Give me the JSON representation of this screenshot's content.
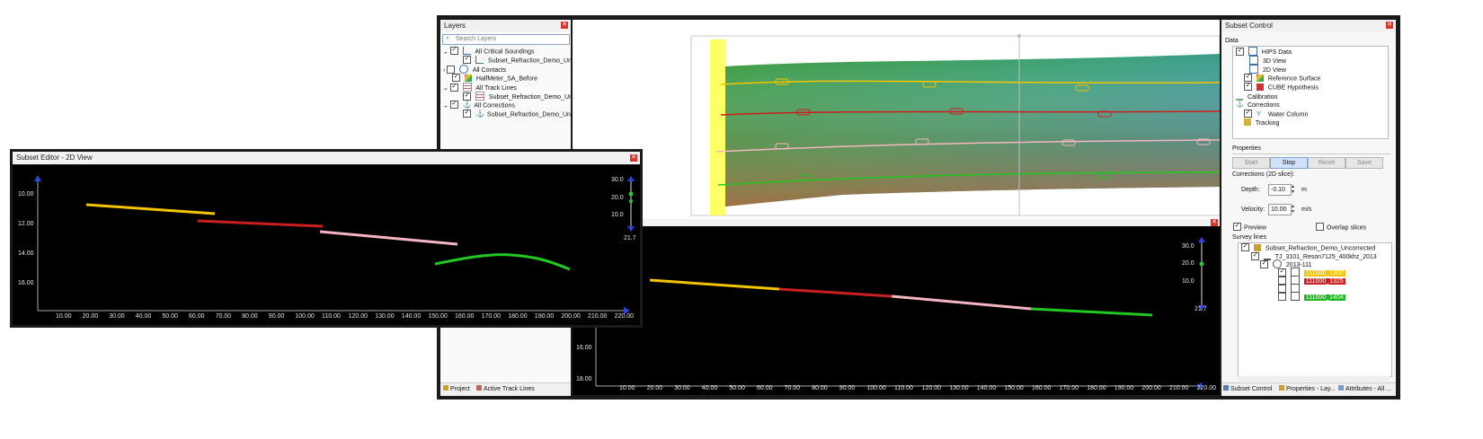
{
  "layers": {
    "title": "Layers",
    "search_placeholder": "Search Layers",
    "items": [
      {
        "label": "All Critical Soundings"
      },
      {
        "label": "Subset_Refraction_Demo_Un..."
      },
      {
        "label": "All Contacts"
      },
      {
        "label": "HalfMeter_SA_Before"
      },
      {
        "label": "All Track Lines"
      },
      {
        "label": "Subset_Refraction_Demo_Un..."
      },
      {
        "label": "All Corrections"
      },
      {
        "label": "Subset_Refraction_Demo_Un..."
      }
    ],
    "bottom_tabs": [
      "Project",
      "Active Track Lines"
    ]
  },
  "subset_control": {
    "title": "Subset Control",
    "data_label": "Data",
    "data_tree": [
      {
        "label": "HIPS Data"
      },
      {
        "label": "3D View"
      },
      {
        "label": "2D View"
      },
      {
        "label": "Reference Surface"
      },
      {
        "label": "CUBE Hypothesis"
      },
      {
        "label": "Calibration"
      },
      {
        "label": "Corrections"
      },
      {
        "label": "Water Column"
      },
      {
        "label": "Tracking"
      }
    ],
    "properties_label": "Properties",
    "buttons": {
      "start": "Start",
      "stop": "Stop",
      "reset": "Reset",
      "save": "Save"
    },
    "corrections_label": "Corrections (2D slice):",
    "depth_label": "Depth:",
    "depth_value": "-0.10",
    "depth_unit": "m",
    "velocity_label": "Velocity:",
    "velocity_value": "10.00",
    "velocity_unit": "m/s",
    "preview_label": "Preview",
    "overlap_label": "Overlap slices",
    "survey_lines_label": "Survey lines",
    "survey_tree": [
      {
        "label": "Subset_Refraction_Demo_Uncorrected"
      },
      {
        "label": "TJ_3101_Reson7125_400khz_2013"
      },
      {
        "label": "2013-111"
      },
      {
        "label": "111000_1300",
        "color": "#f5c400"
      },
      {
        "label": "111000_1325",
        "color": "#cc1f1f"
      },
      {
        "label": "",
        "color": "#ffffff"
      },
      {
        "label": "111000_1404",
        "color": "#22b822"
      }
    ],
    "bottom_tabs": [
      "Subset Control",
      "Properties - Lay...",
      "Attributes - All ..."
    ]
  },
  "editor_2d": {
    "title": "Subset Editor - 2D View",
    "y_ticks": [
      "10.00",
      "12.00",
      "14.00",
      "16.00"
    ],
    "x_ticks": [
      "10.00",
      "20.00",
      "30.00",
      "40.00",
      "50.00",
      "60.00",
      "70.00",
      "80.00",
      "90.00",
      "100.00",
      "110.00",
      "120.00",
      "130.00",
      "140.00",
      "150.00",
      "160.00",
      "170.00",
      "180.00",
      "190.00",
      "200.00",
      "210.00",
      "220.00"
    ],
    "scale_ticks": [
      "30.0",
      "20.0",
      "10.0"
    ],
    "scale_bottom": "21.7"
  },
  "editor_main": {
    "y_ticks": [
      "16.00",
      "18.00"
    ],
    "x_ticks": [
      "10.00",
      "20.00",
      "30.00",
      "40.00",
      "50.00",
      "60.00",
      "70.00",
      "80.00",
      "90.00",
      "100.00",
      "110.00",
      "120.00",
      "130.00",
      "140.00",
      "150.00",
      "160.00",
      "170.00",
      "180.00",
      "190.00",
      "200.00",
      "210.00",
      "220.00"
    ],
    "scale_ticks": [
      "30.0",
      "20.0",
      "10.0"
    ],
    "scale_bottom": "21.7"
  },
  "colors": {
    "yellow": "#f5c400",
    "red": "#cc1f1f",
    "pink": "#f4b6c2",
    "green": "#22c822",
    "selection": "#ffff33"
  }
}
